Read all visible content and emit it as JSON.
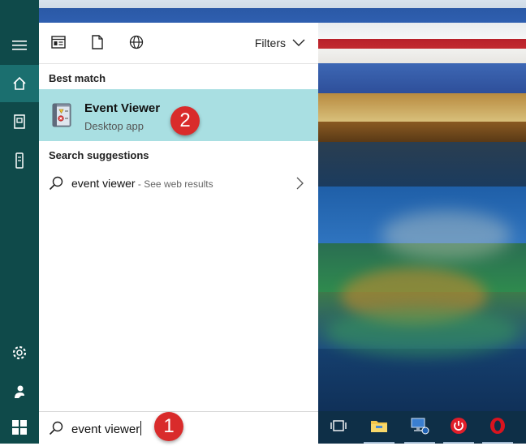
{
  "rail": {
    "items": [
      {
        "name": "hamburger-menu",
        "icon": "hamburger-icon"
      },
      {
        "name": "home",
        "icon": "home-icon",
        "active": true
      },
      {
        "name": "notebook",
        "icon": "notebook-icon"
      },
      {
        "name": "devices",
        "icon": "phone-icon"
      },
      {
        "name": "settings",
        "icon": "gear-icon"
      },
      {
        "name": "feedback",
        "icon": "feedback-icon"
      },
      {
        "name": "start",
        "icon": "windows-icon"
      }
    ]
  },
  "panel": {
    "top_icons": [
      "apps-icon",
      "document-icon",
      "web-icon"
    ],
    "filters_label": "Filters",
    "best_match_heading": "Best match",
    "best_match": {
      "title": "Event Viewer",
      "subtitle": "Desktop app",
      "icon": "event-viewer-icon"
    },
    "suggestions_heading": "Search suggestions",
    "suggestion": {
      "text": "event viewer",
      "web_hint": " - See web results"
    }
  },
  "search": {
    "value": "event viewer"
  },
  "annotations": {
    "step1": "1",
    "step2": "2"
  },
  "taskbar": {
    "items": [
      "task-view-icon",
      "file-explorer-icon",
      "network-icon",
      "power-icon",
      "opera-icon"
    ]
  },
  "colors": {
    "rail": "#0f4a4a",
    "rail_active": "#1b6f6f",
    "highlight": "#a9dfe2",
    "badge": "#d92b2b",
    "taskbar": "#0e2f47"
  }
}
